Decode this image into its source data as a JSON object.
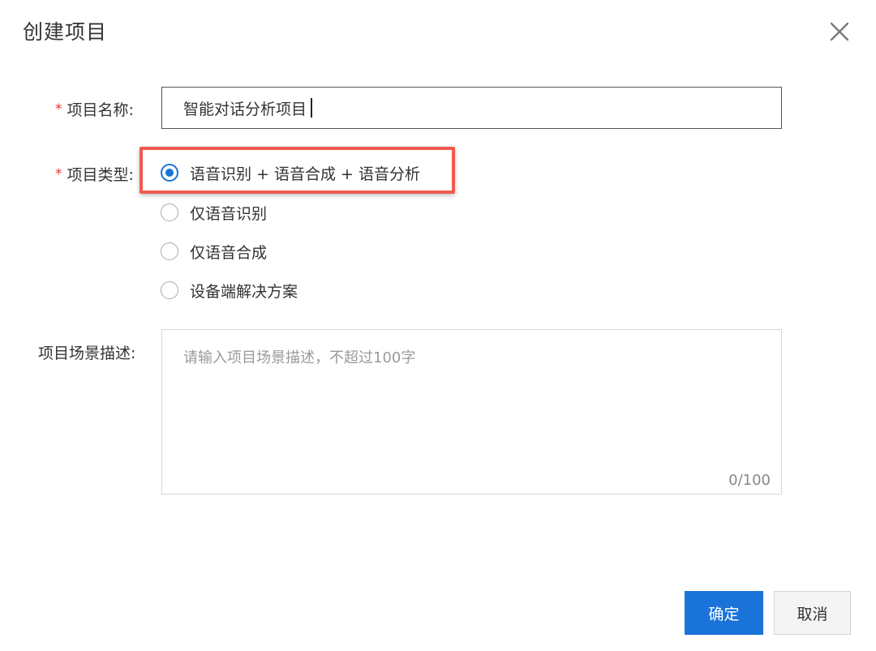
{
  "dialog": {
    "title": "创建项目",
    "close_icon": "close-icon"
  },
  "form": {
    "name": {
      "label": "项目名称:",
      "required_mark": "*",
      "value": "智能对话分析项目"
    },
    "type": {
      "label": "项目类型:",
      "required_mark": "*",
      "options": [
        {
          "label": "语音识别 + 语音合成 + 语音分析",
          "checked": true
        },
        {
          "label": "仅语音识别",
          "checked": false
        },
        {
          "label": "仅语音合成",
          "checked": false
        },
        {
          "label": "设备端解决方案",
          "checked": false
        }
      ]
    },
    "description": {
      "label": "项目场景描述:",
      "placeholder": "请输入项目场景描述，不超过100字",
      "value": "",
      "counter": "0/100"
    }
  },
  "footer": {
    "ok_label": "确定",
    "cancel_label": "取消"
  },
  "colors": {
    "primary": "#1a73d9",
    "required": "#e4393c",
    "highlight_border": "#ef5a4f"
  }
}
